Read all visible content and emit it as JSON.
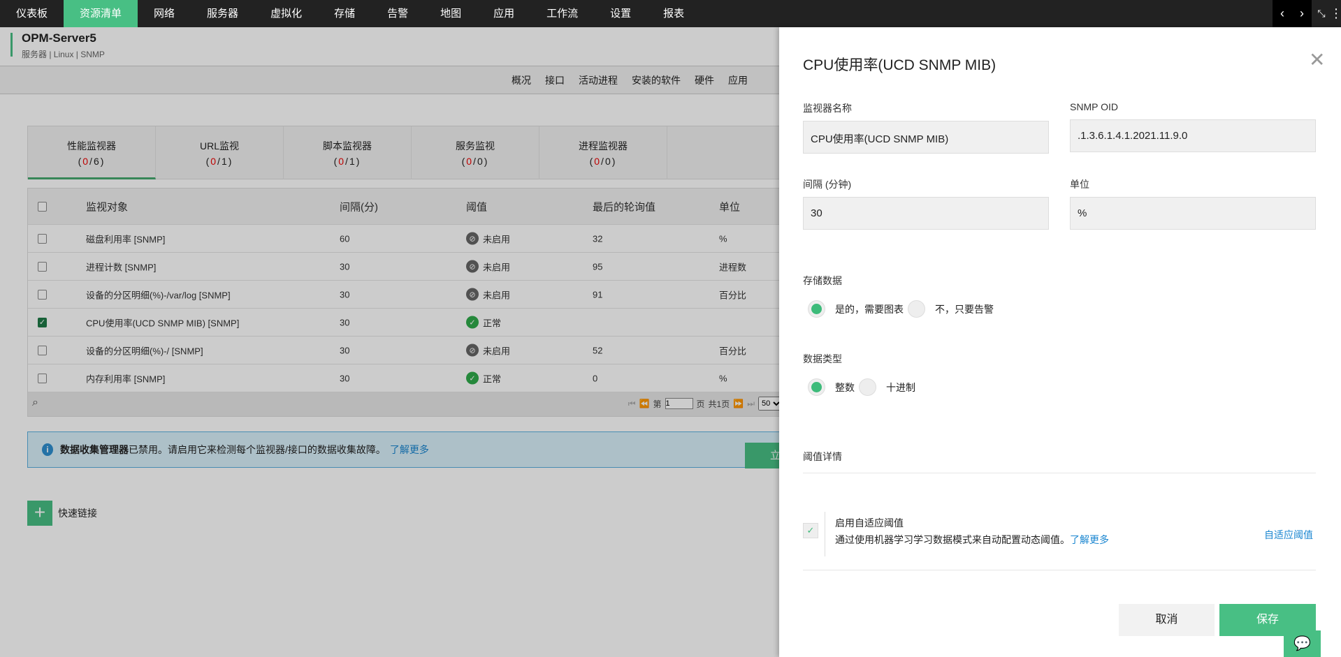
{
  "nav": {
    "items": [
      "仪表板",
      "资源清单",
      "网络",
      "服务器",
      "虚拟化",
      "存储",
      "告警",
      "地图",
      "应用",
      "工作流",
      "设置",
      "报表"
    ],
    "active": 1
  },
  "header": {
    "title": "OPM-Server5",
    "subtitle": "服务器 | Linux | SNMP",
    "tabs": [
      "概况",
      "接口",
      "活动进程",
      "安装的软件",
      "硬件",
      "应用"
    ]
  },
  "monitor_tabs": [
    {
      "label": "性能监视器",
      "count_red": "0",
      "count_total": "6"
    },
    {
      "label": "URL监视",
      "count_red": "0",
      "count_total": "1"
    },
    {
      "label": "脚本监视器",
      "count_red": "0",
      "count_total": "1"
    },
    {
      "label": "服务监视",
      "count_red": "0",
      "count_total": "0"
    },
    {
      "label": "进程监视器",
      "count_red": "0",
      "count_total": "0"
    }
  ],
  "table": {
    "headers": [
      "监视对象",
      "间隔(分)",
      "阈值",
      "最后的轮询值",
      "单位"
    ],
    "rows": [
      {
        "name": "磁盘利用率 [SNMP]",
        "interval": "60",
        "threshold": "未启用",
        "status": "disabled",
        "value": "32",
        "unit": "%",
        "checked": false
      },
      {
        "name": "进程计数 [SNMP]",
        "interval": "30",
        "threshold": "未启用",
        "status": "disabled",
        "value": "95",
        "unit": "进程数",
        "checked": false
      },
      {
        "name": "设备的分区明细(%)-/var/log [SNMP]",
        "interval": "30",
        "threshold": "未启用",
        "status": "disabled",
        "value": "91",
        "unit": "百分比",
        "checked": false
      },
      {
        "name": "CPU使用率(UCD SNMP MIB) [SNMP]",
        "interval": "30",
        "threshold": "正常",
        "status": "ok",
        "value": "",
        "unit": "",
        "checked": true
      },
      {
        "name": "设备的分区明细(%)-/ [SNMP]",
        "interval": "30",
        "threshold": "未启用",
        "status": "disabled",
        "value": "52",
        "unit": "百分比",
        "checked": false
      },
      {
        "name": "内存利用率 [SNMP]",
        "interval": "30",
        "threshold": "正常",
        "status": "ok",
        "value": "0",
        "unit": "%",
        "checked": false
      }
    ],
    "pager": {
      "prefix": "第",
      "page": "1",
      "suffix": "页",
      "total": "共1页",
      "per_page": "50"
    }
  },
  "info": {
    "bold": "数据收集管理器",
    "text": "已禁用。请启用它来检测每个监视器/接口的数据收集故障。",
    "link": "了解更多",
    "button": "立即启用"
  },
  "quick_links": "快速链接",
  "panel": {
    "title": "CPU使用率(UCD SNMP MIB)",
    "name_label": "监视器名称",
    "name_value": "CPU使用率(UCD SNMP MIB)",
    "oid_label": "SNMP OID",
    "oid_value": ".1.3.6.1.4.1.2021.11.9.0",
    "interval_label": "间隔 (分钟)",
    "interval_value": "30",
    "unit_label": "单位",
    "unit_value": "%",
    "store_label": "存储数据",
    "store_yes": "是的，需要图表",
    "store_no": "不，只要告警",
    "type_label": "数据类型",
    "type_int": "整数",
    "type_dec": "十进制",
    "threshold_label": "阈值详情",
    "adaptive_title": "启用自适应阈值",
    "adaptive_desc": "通过使用机器学习学习数据模式来自动配置动态阈值。",
    "adaptive_link": "了解更多",
    "adaptive_right": "自适应阈值",
    "cancel": "取消",
    "save": "保存"
  }
}
